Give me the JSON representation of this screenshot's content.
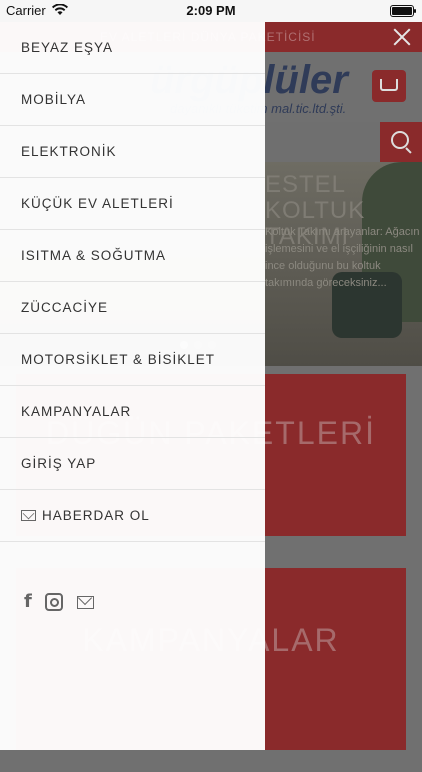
{
  "status_bar": {
    "carrier": "Carrier",
    "time": "2:09 PM"
  },
  "background_page": {
    "top_tagline": "EV ALETLERİ DÜNYA PAKETİCİSİ",
    "logo_text": "ürgüplüler",
    "logo_subtitle": "dayanıklı tüketim mal.tic.ltd.şti.",
    "slider": {
      "title": "ESTEL KOLTUK TAKIMI",
      "description": "Koltuk Takımı arayanlar: Ağacın işlemesini ve el işçiliğinin nasıl ince olduğunu bu koltuk takımında göreceksiniz..."
    },
    "panels": [
      "DÜĞÜN PAKETLERİ",
      "KAMPANYALAR"
    ]
  },
  "drawer": {
    "menu_items": [
      {
        "label": "BEYAZ EŞYA"
      },
      {
        "label": "MOBİLYA"
      },
      {
        "label": "ELEKTRONİK"
      },
      {
        "label": "KÜÇÜK EV ALETLERİ"
      },
      {
        "label": "ISITMA & SOĞUTMA"
      },
      {
        "label": "ZÜCCACİYE"
      },
      {
        "label": "MOTORSİKLET & BİSİKLET"
      },
      {
        "label": "KAMPANYALAR"
      },
      {
        "label": "GİRİŞ YAP"
      },
      {
        "label": "HABERDAR OL"
      }
    ],
    "social_icons": [
      "facebook-icon",
      "instagram-icon",
      "mail-icon"
    ]
  },
  "colors": {
    "brand_red": "#b33a3c",
    "overlay": "#6b6b6b",
    "drawer_bg": "#ffffff"
  }
}
